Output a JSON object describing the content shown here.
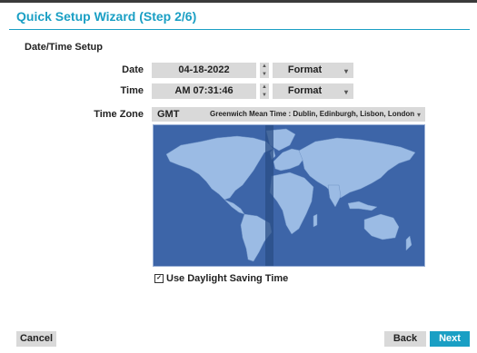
{
  "header": {
    "title": "Quick Setup Wizard (Step 2/6)"
  },
  "section": {
    "title": "Date/Time Setup"
  },
  "date": {
    "label": "Date",
    "value": "04-18-2022",
    "format_label": "Format"
  },
  "time": {
    "label": "Time",
    "value": "AM 07:31:46",
    "format_label": "Format"
  },
  "timezone": {
    "label": "Time Zone",
    "code": "GMT",
    "name": "Greenwich Mean Time : Dublin, Edinburgh, Lisbon, London"
  },
  "dst": {
    "label": "Use Daylight Saving Time",
    "checked": true
  },
  "footer": {
    "cancel_label": "Cancel",
    "back_label": "Back",
    "next_label": "Next"
  },
  "colors": {
    "accent": "#1a9fc4",
    "map_ocean": "#3d65a8",
    "map_land": "#9bbbe4",
    "selected_zone": "#2a4d86"
  },
  "icons": {
    "spin_up": "triangle-up-icon",
    "spin_down": "triangle-down-icon",
    "dropdown": "chevron-down-icon",
    "checkbox": "checkbox-checked-icon"
  }
}
